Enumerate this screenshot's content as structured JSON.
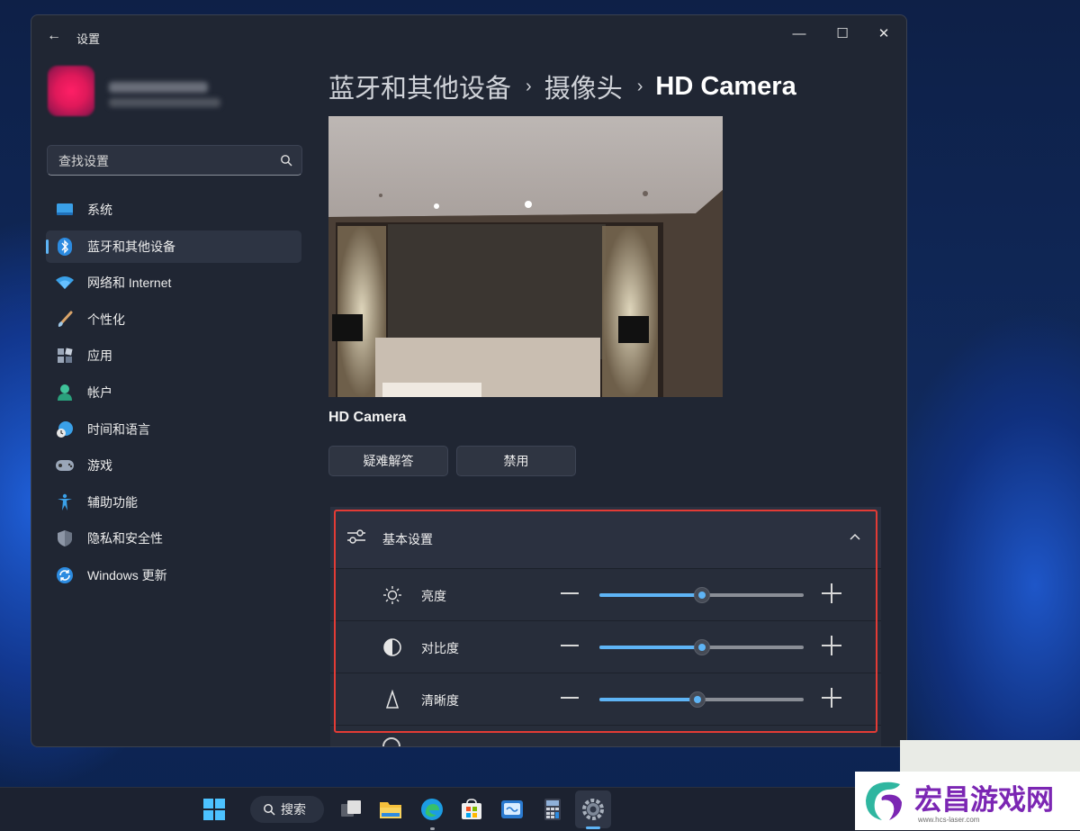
{
  "window": {
    "app_title": "设置",
    "back_label": "←",
    "minimize_label": "—",
    "maximize_label": "☐",
    "close_label": "✕"
  },
  "search": {
    "placeholder": "查找设置"
  },
  "sidebar": {
    "items": [
      {
        "label": "系统",
        "icon": "system-icon",
        "active": false
      },
      {
        "label": "蓝牙和其他设备",
        "icon": "bluetooth-icon",
        "active": true
      },
      {
        "label": "网络和 Internet",
        "icon": "wifi-icon",
        "active": false
      },
      {
        "label": "个性化",
        "icon": "brush-icon",
        "active": false
      },
      {
        "label": "应用",
        "icon": "apps-icon",
        "active": false
      },
      {
        "label": "帐户",
        "icon": "account-icon",
        "active": false
      },
      {
        "label": "时间和语言",
        "icon": "globe-clock-icon",
        "active": false
      },
      {
        "label": "游戏",
        "icon": "gamepad-icon",
        "active": false
      },
      {
        "label": "辅助功能",
        "icon": "accessibility-icon",
        "active": false
      },
      {
        "label": "隐私和安全性",
        "icon": "shield-icon",
        "active": false
      },
      {
        "label": "Windows 更新",
        "icon": "update-icon",
        "active": false
      }
    ]
  },
  "breadcrumb": {
    "items": [
      "蓝牙和其他设备",
      "摄像头"
    ],
    "current": "HD Camera",
    "separator": "›"
  },
  "device": {
    "name": "HD Camera",
    "troubleshoot_label": "疑难解答",
    "disable_label": "禁用"
  },
  "basic_settings": {
    "title": "基本设置",
    "expanded": true,
    "sliders": [
      {
        "label": "亮度",
        "icon": "sun-icon",
        "value": 0.5
      },
      {
        "label": "对比度",
        "icon": "contrast-icon",
        "value": 0.5
      },
      {
        "label": "清晰度",
        "icon": "sharpness-icon",
        "value": 0.48
      }
    ]
  },
  "taskbar": {
    "search_label": "搜索",
    "apps": [
      "start-icon",
      "search",
      "task-view-icon",
      "file-explorer-icon",
      "edge-icon",
      "store-icon",
      "remote-desktop-icon",
      "calculator-icon",
      "settings-icon"
    ],
    "active_app": "settings-icon"
  },
  "watermark": {
    "title": "宏昌游戏网",
    "url": "www.hcs-laser.com"
  },
  "colors": {
    "accent": "#5eb4f5",
    "window_bg": "#202633",
    "highlight": "#e33b35",
    "watermark": "#7b26b3"
  }
}
